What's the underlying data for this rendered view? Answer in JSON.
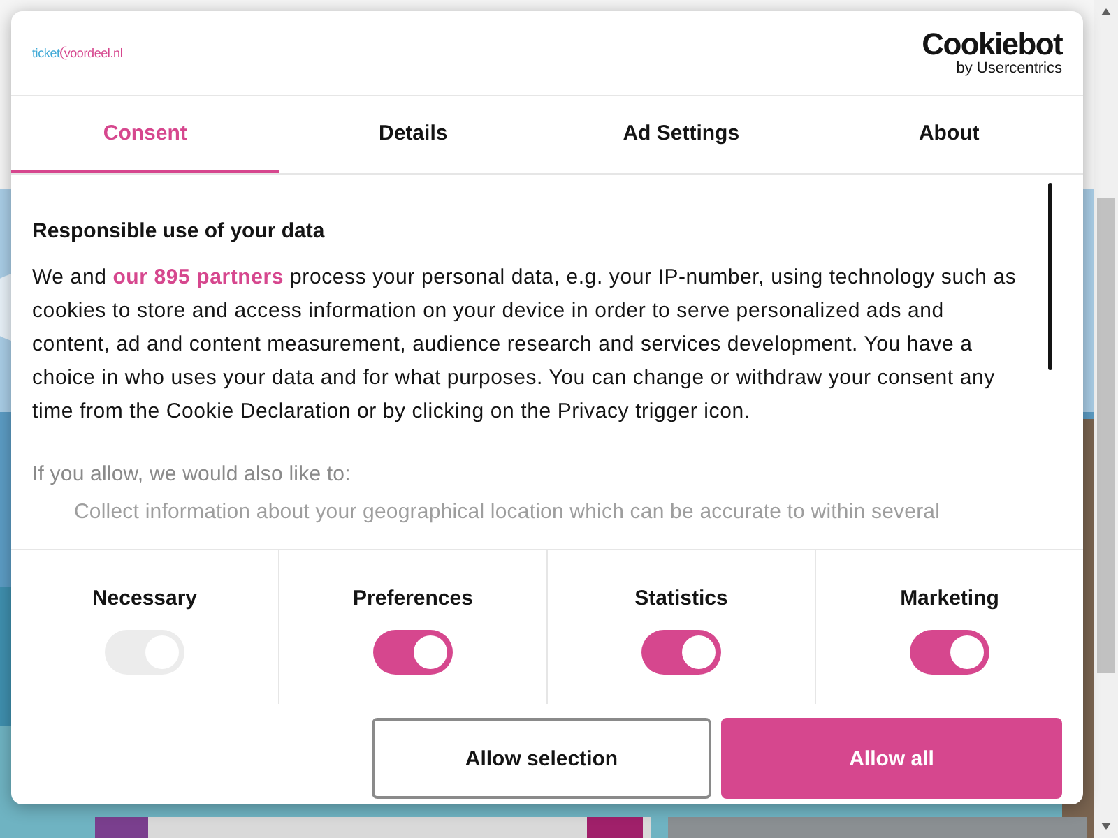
{
  "logo": {
    "brand": "ticket",
    "brand_accent": "voordeel.nl"
  },
  "provider": {
    "name": "Cookiebot",
    "byline": "by Usercentrics"
  },
  "tabs": [
    {
      "label": "Consent",
      "selected": true
    },
    {
      "label": "Details",
      "selected": false
    },
    {
      "label": "Ad Settings",
      "selected": false
    },
    {
      "label": "About",
      "selected": false
    }
  ],
  "content": {
    "heading": "Responsible use of your data",
    "paragraph": {
      "before": "We and ",
      "link": "our 895 partners",
      "after": " process your personal data, e.g. your IP-number, using technology such as cookies to store and access information on your device in order to serve personalized ads and content, ad and content measurement, audience research and services development. You have a choice in who uses your data and for what purposes. You can change or withdraw your consent any time from the Cookie Declaration or by clicking on the Privacy trigger icon."
    },
    "intro": "If you allow, we would also like to:",
    "list_item": "Collect information about your geographical location which can be accurate to within several"
  },
  "categories": [
    {
      "label": "Necessary",
      "checked": true,
      "disabled": true
    },
    {
      "label": "Preferences",
      "checked": true,
      "disabled": false
    },
    {
      "label": "Statistics",
      "checked": true,
      "disabled": false
    },
    {
      "label": "Marketing",
      "checked": true,
      "disabled": false
    }
  ],
  "buttons": [
    {
      "label": "Allow selection",
      "kind": "outline"
    },
    {
      "label": "Allow all",
      "kind": "primary"
    }
  ]
}
